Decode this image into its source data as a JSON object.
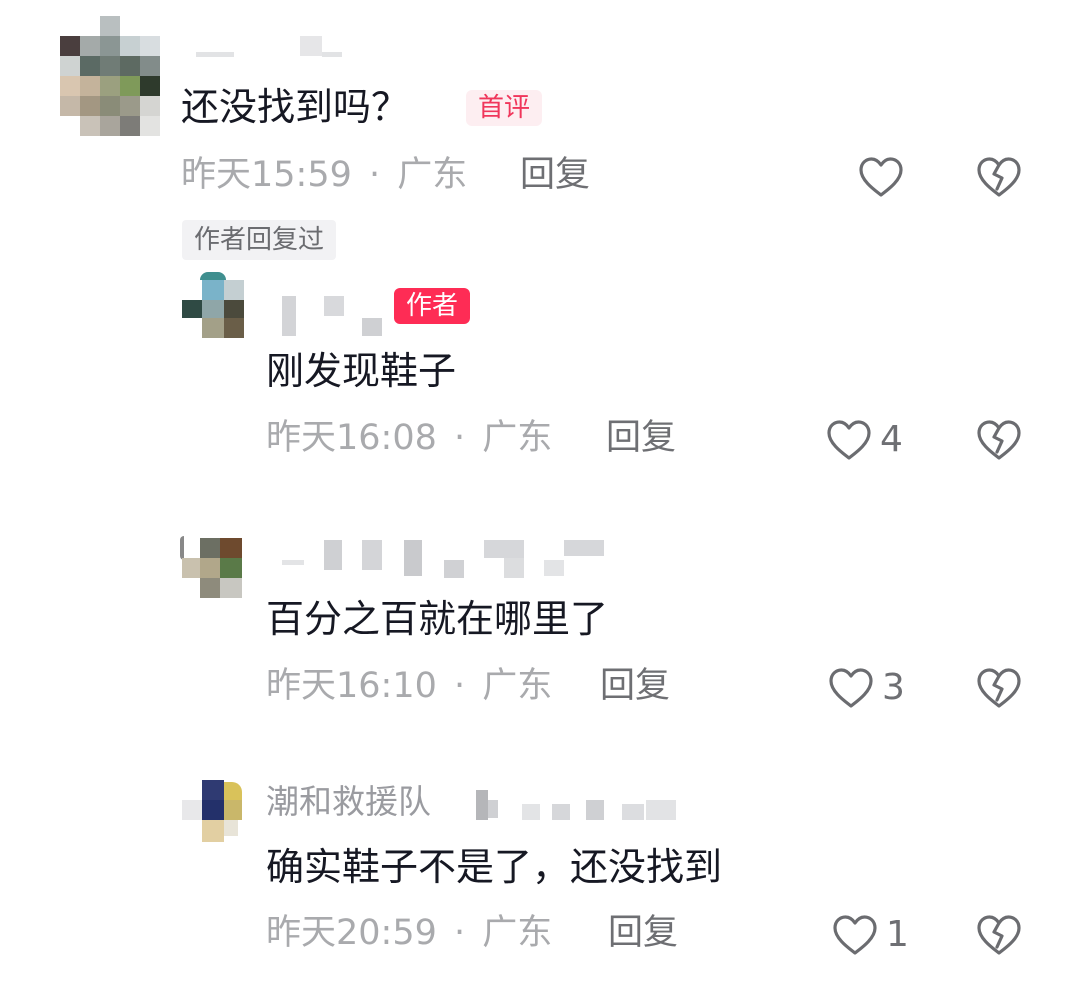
{
  "comments": [
    {
      "content": "还没找到吗？",
      "badge": "首评",
      "time": "昨天15:59",
      "sep": "·",
      "location": "广东",
      "reply_label": "回复",
      "like_count": "",
      "author_replied_tag": "作者回复过"
    },
    {
      "badge": "作者",
      "content": "刚发现鞋子",
      "time": "昨天16:08",
      "sep": "·",
      "location": "广东",
      "reply_label": "回复",
      "like_count": "4"
    },
    {
      "content": "百分之百就在哪里了",
      "time": "昨天16:10",
      "sep": "·",
      "location": "广东",
      "reply_label": "回复",
      "like_count": "3"
    },
    {
      "username": "潮和救援队",
      "content": "确实鞋子不是了，还没找到",
      "time": "昨天20:59",
      "sep": "·",
      "location": "广东",
      "reply_label": "回复",
      "like_count": "1"
    }
  ],
  "icons": {
    "like": "heart-outline-icon",
    "dislike": "broken-heart-icon"
  },
  "colors": {
    "accent": "#fe2c55",
    "first_badge_bg": "#fdeef1",
    "meta_text": "#a9aaad"
  }
}
